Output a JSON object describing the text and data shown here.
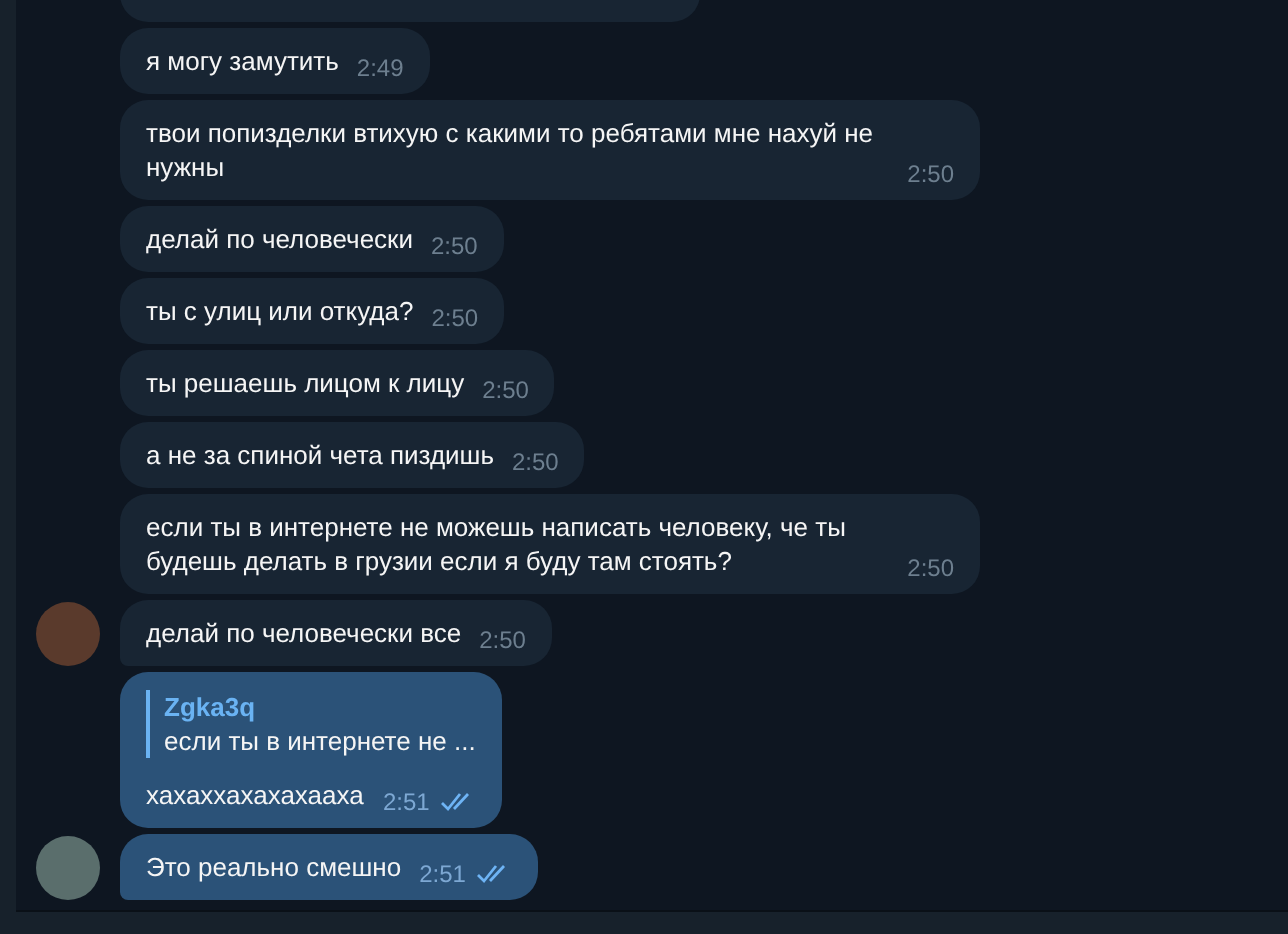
{
  "messages": [
    {
      "kind": "incoming",
      "text": "я могу замутить",
      "time": "2:49",
      "show_avatar": false
    },
    {
      "kind": "incoming",
      "text": "твои попизделки втихую с какими то ребятами мне нахуй не нужны",
      "time": "2:50",
      "show_avatar": false
    },
    {
      "kind": "incoming",
      "text": "делай по человечески",
      "time": "2:50",
      "show_avatar": false
    },
    {
      "kind": "incoming",
      "text": "ты с улиц или откуда?",
      "time": "2:50",
      "show_avatar": false
    },
    {
      "kind": "incoming",
      "text": "ты решаешь лицом к лицу",
      "time": "2:50",
      "show_avatar": false
    },
    {
      "kind": "incoming",
      "text": "а не за спиной чета пиздишь",
      "time": "2:50",
      "show_avatar": false
    },
    {
      "kind": "incoming",
      "text": "если ты в интернете не можешь написать человеку, че ты будешь делать в грузии если я буду там стоять?",
      "time": "2:50",
      "show_avatar": false
    },
    {
      "kind": "incoming",
      "text": "делай по человечески все",
      "time": "2:50",
      "show_avatar": true
    },
    {
      "kind": "outgoing",
      "reply": {
        "author": "Zgka3q",
        "text": "если ты в интернете не ..."
      },
      "text": "хахаххахахахааха",
      "time": "2:51",
      "read": true,
      "show_avatar": false
    },
    {
      "kind": "outgoing",
      "text": "Это реально смешно",
      "time": "2:51",
      "read": true,
      "show_avatar": true
    }
  ]
}
